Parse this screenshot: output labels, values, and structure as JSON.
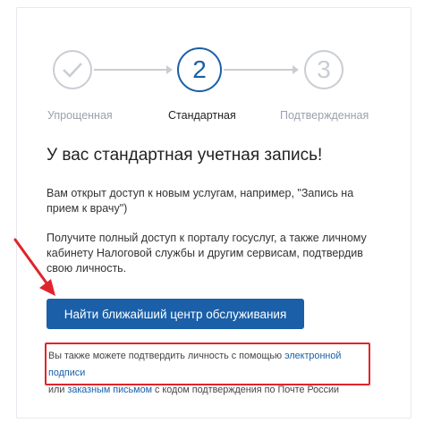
{
  "steps": [
    {
      "number": "",
      "label": "Упрощенная",
      "state": "done",
      "icon": "checkmark-icon"
    },
    {
      "number": "2",
      "label": "Стандартная",
      "state": "active"
    },
    {
      "number": "3",
      "label": "Подтвержденная",
      "state": "pending"
    }
  ],
  "main": {
    "title": "У вас стандартная учетная запись!",
    "para1": "Вам открыт доступ к новым услугам, например, \"Запись на прием к врачу\")",
    "para2": "Получите полный доступ к порталу госуслуг, а также личному кабинету Налоговой службы и другим сервисам, подтвердив свою личность.",
    "find_button": "Найти ближайший центр обслуживания"
  },
  "note": {
    "part1": "Вы также можете подтвердить личность с помощью ",
    "link1": "электронной подписи",
    "part2": "или ",
    "link2": "заказным письмом",
    "part3": " с кодом подтверждения по Почте России"
  },
  "colors": {
    "accent": "#1a5fa8",
    "highlight": "#e0242b",
    "inactive": "#c9cdd3"
  }
}
